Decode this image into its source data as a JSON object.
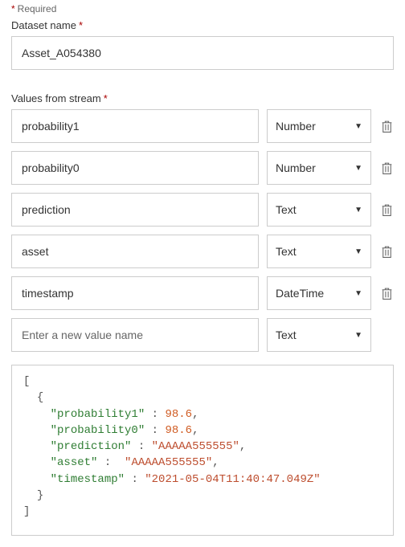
{
  "required_note": "Required",
  "dataset_name": {
    "label": "Dataset name",
    "value": "Asset_A054380"
  },
  "values_from_stream": {
    "label": "Values from stream",
    "rows": [
      {
        "name": "probability1",
        "type": "Number"
      },
      {
        "name": "probability0",
        "type": "Number"
      },
      {
        "name": "prediction",
        "type": "Text"
      },
      {
        "name": "asset",
        "type": "Text"
      },
      {
        "name": "timestamp",
        "type": "DateTime"
      }
    ],
    "new_row": {
      "placeholder": "Enter a new value name",
      "type": "Text"
    }
  },
  "json_preview": {
    "keys": {
      "probability1": "\"probability1\"",
      "probability0": "\"probability0\"",
      "prediction": "\"prediction\"",
      "asset": "\"asset\"",
      "timestamp": "\"timestamp\""
    },
    "values": {
      "probability1": "98.6",
      "probability0": "98.6",
      "prediction": "\"AAAAA555555\"",
      "asset": "\"AAAAA555555\"",
      "timestamp": "\"2021-05-04T11:40:47.049Z\""
    }
  }
}
